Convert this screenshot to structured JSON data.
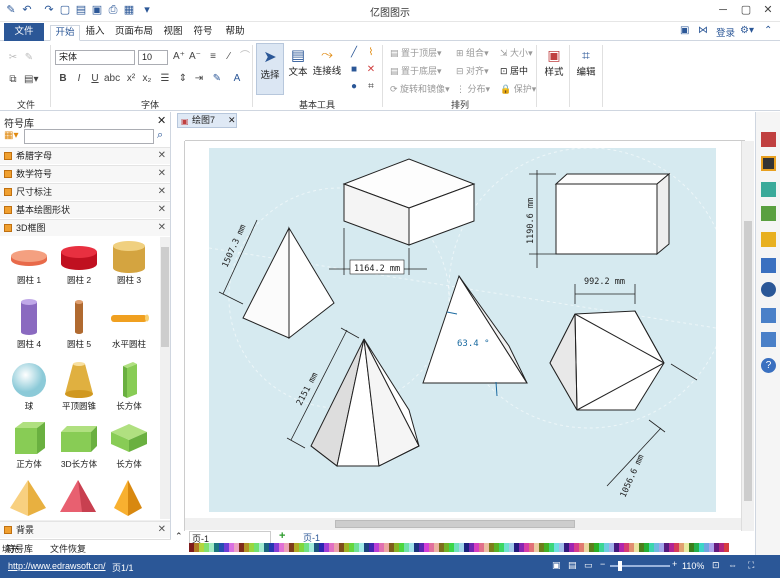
{
  "app": {
    "title": "亿图图示",
    "login": "登录"
  },
  "tabs": {
    "file": "文件",
    "items": [
      "开始",
      "插入",
      "页面布局",
      "视图",
      "符号",
      "帮助"
    ]
  },
  "ribbon": {
    "font_name": "宋体",
    "font_size": "10",
    "groups": [
      "文件",
      "字体",
      "基本工具",
      "排列",
      "样式",
      "编辑"
    ],
    "tools": {
      "select": "选择",
      "text": "文本",
      "connector": "连接线"
    },
    "arrange": [
      "置于顶层",
      "组合",
      "大小",
      "置于底层",
      "对齐",
      "居中",
      "旋转和镜像",
      "分布",
      "保护"
    ],
    "style": "样式",
    "edit": "编辑"
  },
  "library": {
    "title": "符号库",
    "categories": [
      "希腊字母",
      "数学符号",
      "尺寸标注",
      "基本绘图形状",
      "3D框图"
    ],
    "shapes": [
      "圆柱 1",
      "圆柱 2",
      "圆柱 3",
      "圆柱 4",
      "圆柱 5",
      "水平圆柱",
      "球",
      "平顶圆锥",
      "长方体",
      "正方体",
      "3D长方体",
      "长方体"
    ],
    "background": "背景",
    "bottom_tabs": [
      "符号库",
      "文件恢复"
    ]
  },
  "document": {
    "tab": "绘图7",
    "page_label": "页-1",
    "page_tab": "页-1",
    "fill_label": "填充"
  },
  "drawing": {
    "dimensions": [
      "1164.2 mm",
      "1190.6 mm",
      "1507.3 mm",
      "992.2 mm",
      "63.4 °",
      "2151 mm",
      "1056.6 mm"
    ]
  },
  "status": {
    "url": "http://www.edrawsoft.cn/",
    "page": "页1/1",
    "zoom": "110%"
  },
  "colors": {
    "accent": "#2b5797",
    "page_bg": "#d6eaf0"
  }
}
